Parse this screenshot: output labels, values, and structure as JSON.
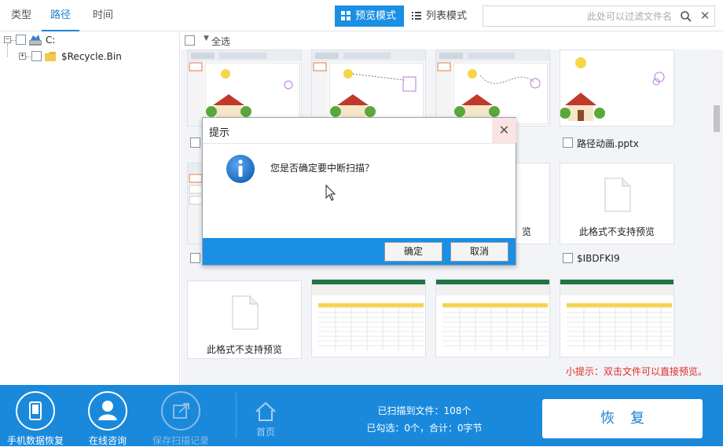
{
  "tabs": [
    {
      "label": "类型",
      "active": false
    },
    {
      "label": "路径",
      "active": true
    },
    {
      "label": "时间",
      "active": false
    }
  ],
  "view_modes": {
    "preview": "预览模式",
    "list": "列表模式"
  },
  "filter": {
    "placeholder": "此处可以过滤文件名",
    "search_icon": "search-icon",
    "clear_icon": "close-icon"
  },
  "tree": {
    "root": {
      "label": "C:",
      "expander": "−"
    },
    "child": {
      "label": "$Recycle.Bin",
      "expander": "+"
    }
  },
  "select_all": "全选",
  "files": {
    "row1": [
      {
        "name": "",
        "kind": "slide"
      },
      {
        "name": "",
        "kind": "slide"
      },
      {
        "name": "",
        "kind": "slide"
      },
      {
        "name": "路径动画.pptx",
        "kind": "slide-plain"
      }
    ],
    "row2": [
      {
        "name": "",
        "kind": "slide"
      },
      {
        "name": "",
        "kind": "hidden"
      },
      {
        "name": "",
        "kind": "unsupported-partial",
        "partial_label": "览"
      },
      {
        "name": "$IBDFKI9",
        "kind": "unsupported"
      }
    ],
    "row3": [
      {
        "name": "",
        "kind": "unsupported"
      },
      {
        "name": "",
        "kind": "sheet"
      },
      {
        "name": "",
        "kind": "sheet"
      },
      {
        "name": "",
        "kind": "sheet"
      }
    ],
    "unsupported_label": "此格式不支持预览"
  },
  "hint": "小提示：双击文件可以直接预览。",
  "footer": {
    "phone_recovery": "手机数据恢复",
    "online_consult": "在线咨询",
    "save_scan": "保存扫描记录",
    "home": "首页",
    "scanned": "已扫描到文件：108个",
    "selected": "已勾选：0个，合计：0字节",
    "recover": "恢复"
  },
  "dialog": {
    "title": "提示",
    "message": "您是否确定要中断扫描？",
    "ok": "确定",
    "cancel": "取消",
    "close_icon": "close-icon",
    "info_icon": "info-icon"
  },
  "colors": {
    "accent": "#1a89db",
    "hint_red": "#e02a2a"
  }
}
